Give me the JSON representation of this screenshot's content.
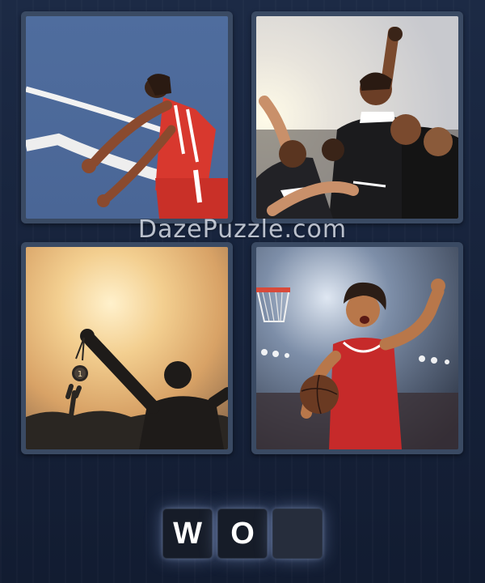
{
  "watermark": "DazePuzzle.com",
  "images": [
    {
      "id": "tile-1",
      "subject": "runner-breaking-finish-tape"
    },
    {
      "id": "tile-2",
      "subject": "team-celebrating"
    },
    {
      "id": "tile-3",
      "subject": "silhouette-holding-medal",
      "medal_label": "1"
    },
    {
      "id": "tile-4",
      "subject": "basketball-player-celebrating"
    }
  ],
  "answer": {
    "slots": [
      "W",
      "O",
      ""
    ]
  },
  "colors": {
    "background": "#1a2640",
    "tile_frame": "#3a4a63",
    "slot": "#1d2433"
  }
}
